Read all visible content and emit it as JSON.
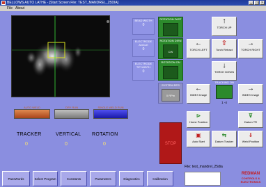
{
  "window": {
    "title": "BELLOWS AUTO LATHE - [Start Screen  File: TEST_MANDREL_25DIA]"
  },
  "menu": {
    "items": [
      "File",
      "About"
    ]
  },
  "readouts": [
    {
      "label": "BEAD WIDTH",
      "value": "0"
    },
    {
      "label": "ELECTRODE ANGLE",
      "value": "0"
    },
    {
      "label": "ELECTRODE TIP WIDTH",
      "value": "0"
    }
  ],
  "indicators": {
    "rotation_fast": {
      "label": "ROTATION FAST"
    },
    "rotation_dir": {
      "label": "ROTATION DIRN",
      "value": "CW"
    },
    "rotation_on": {
      "label": "ROTATION ON"
    },
    "system_rps": {
      "label": "SYSTEM RPS",
      "value": "0 RPm"
    },
    "tracking_on": {
      "label": "TRACKING ON",
      "value": "1 -4"
    }
  },
  "torch": {
    "up": "TORCH UP",
    "left": "TORCH LEFT",
    "retract": "Torch Retract",
    "right": "TORCH RIGHT",
    "down": "TORCH DOWN",
    "index_in": "INDEX Image",
    "index_out": "INDEX Image"
  },
  "actions": {
    "home": "Home Position",
    "datum": "Datum TR",
    "auto_start": "Auto Start",
    "datum_tracker": "Datum Tracker",
    "weld_position": "Weld Position",
    "stop": "STOP"
  },
  "weld_indicators": [
    "AUTO WELD",
    "DRY RUN",
    "SINGLE WELD RUN"
  ],
  "tracker": {
    "labels": [
      "TRACKER",
      "VERTICAL",
      "ROTATION"
    ],
    "values": [
      "0",
      "0",
      "0"
    ]
  },
  "file_label": "File: test_mandrel_25dia",
  "bottom_buttons": [
    "PassWords",
    "Select Program",
    "Constants",
    "Parameters",
    "Diagnostics",
    "Calibration"
  ],
  "logo": {
    "line1": "REDMAN",
    "line2": "CONTROLS &",
    "line3": "ELECTRONICS"
  },
  "colors": {
    "background": "#8a8ee0",
    "indicator_green": "#2c8a2c",
    "stop_red": "#b01818",
    "weld_orange": "#c35a1e"
  }
}
